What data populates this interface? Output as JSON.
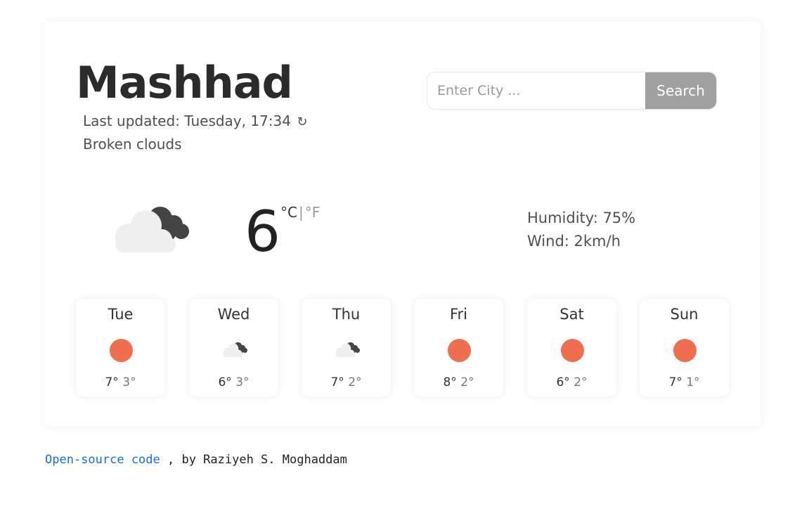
{
  "city": "Mashhad",
  "last_updated_label": "Last updated: Tuesday, 17:34",
  "refresh_symbol": "↻",
  "description": "Broken clouds",
  "search": {
    "placeholder": "Enter City ...",
    "value": "",
    "button_label": "Search",
    "button_color": "#a0a0a0"
  },
  "current": {
    "icon": "broken-clouds-icon",
    "temperature": "6",
    "unit_c": "°C",
    "separator": "|",
    "unit_f": "°F",
    "humidity": "Humidity: 75%",
    "wind": "Wind: 2km/h"
  },
  "forecast": [
    {
      "day": "Tue",
      "icon": "sun-icon",
      "high": "7°",
      "low": "3°"
    },
    {
      "day": "Wed",
      "icon": "broken-clouds-icon",
      "high": "6°",
      "low": "3°"
    },
    {
      "day": "Thu",
      "icon": "broken-clouds-icon",
      "high": "7°",
      "low": "2°"
    },
    {
      "day": "Fri",
      "icon": "sun-icon",
      "high": "8°",
      "low": "2°"
    },
    {
      "day": "Sat",
      "icon": "sun-icon",
      "high": "6°",
      "low": "2°"
    },
    {
      "day": "Sun",
      "icon": "sun-icon",
      "high": "7°",
      "low": "1°"
    }
  ],
  "colors": {
    "sun": "#ee6e4f",
    "link": "#1a6dd8",
    "dark_cloud": "#444444",
    "light_cloud": "#efefef"
  },
  "footer": {
    "link_text": "Open-source code",
    "byline": " , by Raziyeh S. Moghaddam"
  }
}
